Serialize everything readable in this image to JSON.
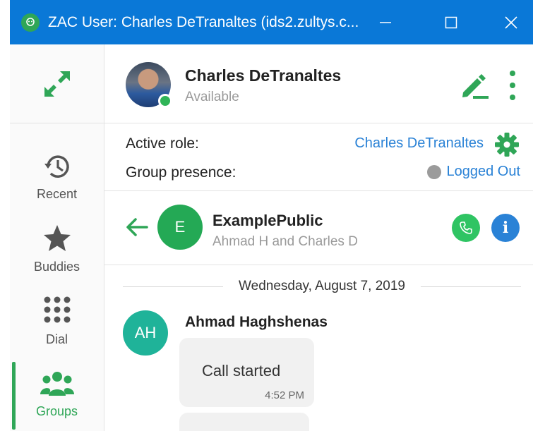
{
  "window": {
    "title": "ZAC User: Charles DeTranaltes (ids2.zultys.c...",
    "app_icon": "zac-logo-icon",
    "controls": [
      "minimize-icon",
      "maximize-icon",
      "close-icon"
    ]
  },
  "rail": {
    "expand_icon": "expand-arrows-icon",
    "items": [
      {
        "label": "Recent",
        "icon": "history-icon",
        "active": false
      },
      {
        "label": "Buddies",
        "icon": "star-icon",
        "active": false
      },
      {
        "label": "Dial",
        "icon": "dialpad-icon",
        "active": false
      },
      {
        "label": "Groups",
        "icon": "groups-icon",
        "active": true
      }
    ]
  },
  "profile": {
    "name": "Charles DeTranaltes",
    "status": "Available"
  },
  "roles": {
    "active_role_label": "Active role:",
    "active_role_value": "Charles DeTranaltes",
    "group_presence_label": "Group presence:",
    "group_presence_value": "Logged Out"
  },
  "conversation": {
    "avatar_letter": "E",
    "name": "ExamplePublic",
    "members": "Ahmad H and Charles D"
  },
  "messages": {
    "date": "Wednesday, August 7, 2019",
    "sender_initials": "AH",
    "sender_name": "Ahmad Haghshenas",
    "text": "Call started",
    "time": "4:52 PM"
  },
  "colors": {
    "titlebar": "#0a78d7",
    "accent_green": "#2fa657",
    "link_blue": "#2a82d6"
  }
}
